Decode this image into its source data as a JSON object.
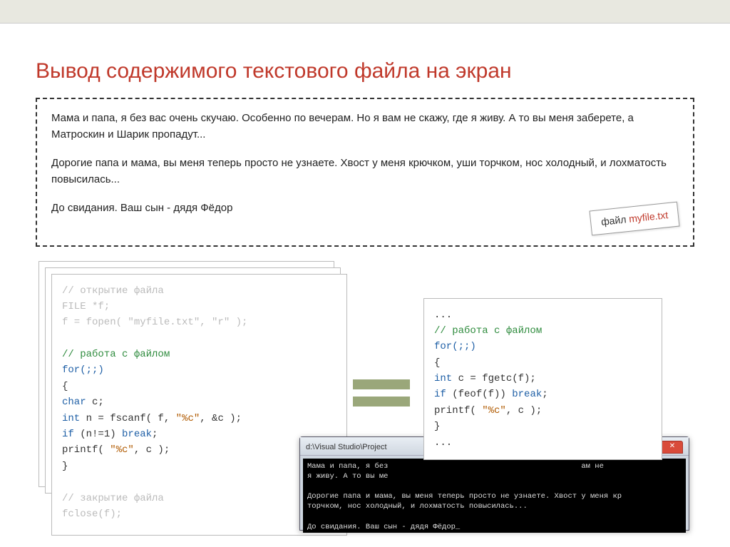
{
  "title": "Вывод содержимого текстового файла на экран",
  "filebox": {
    "p1": "Мама и папа, я без вас очень скучаю. Особенно по вечерам. Но я вам не скажу, где я живу. А то вы меня заберете, а Матроскин и Шарик пропадут...",
    "p2": "Дорогие папа и мама, вы меня теперь просто не узнаете. Хвост у меня крючком, уши торчком, нос холодный, и лохматость повысилась...",
    "p3": "До свидания. Ваш сын - дядя Фёдор",
    "label_pre": "файл ",
    "label_name": "myfile.txt"
  },
  "code_left": {
    "c1": "// открытие файла",
    "c2": "FILE *f;",
    "c3": "f = fopen( \"myfile.txt\", \"r\" );",
    "c4": "// работа с файлом",
    "c5": "for(;;)",
    "c6": "{",
    "c7a": "    char",
    "c7b": " c;",
    "c8a": "    int",
    "c8b": " n = fscanf( f, ",
    "c8c": "\"%c\"",
    "c8d": ", &c );",
    "c9a": "    if",
    "c9b": " (n!=1) ",
    "c9c": "break",
    "c9d": ";",
    "c10a": "    printf( ",
    "c10b": "\"%c\"",
    "c10c": ", c );",
    "c11": "}",
    "c12": "// закрытие файла",
    "c13": "fclose(f);"
  },
  "code_right": {
    "r0": "...",
    "r1": "// работа с файлом",
    "r2": "for(;;)",
    "r3": "{",
    "r4a": "    int",
    "r4b": " c = fgetc(f);",
    "r5a": "    if",
    "r5b": " (feof(f)) ",
    "r5c": "break",
    "r5d": ";",
    "r6a": "    printf( ",
    "r6b": "\"%c\"",
    "r6c": ", c );",
    "r7": "}",
    "r8": "..."
  },
  "console": {
    "title": "d:\\Visual Studio\\Project",
    "line1": "Мама и папа, я без",
    "line1b": "ам не",
    "line2": "я живу. А то вы ме",
    "line3": "Дорогие папа и мама, вы меня теперь просто не узнаете. Хвост у меня кр",
    "line4": "торчком, нос холодный, и лохматость повысилась...",
    "line5": "До свидания. Ваш сын - дядя Фёдор_"
  }
}
